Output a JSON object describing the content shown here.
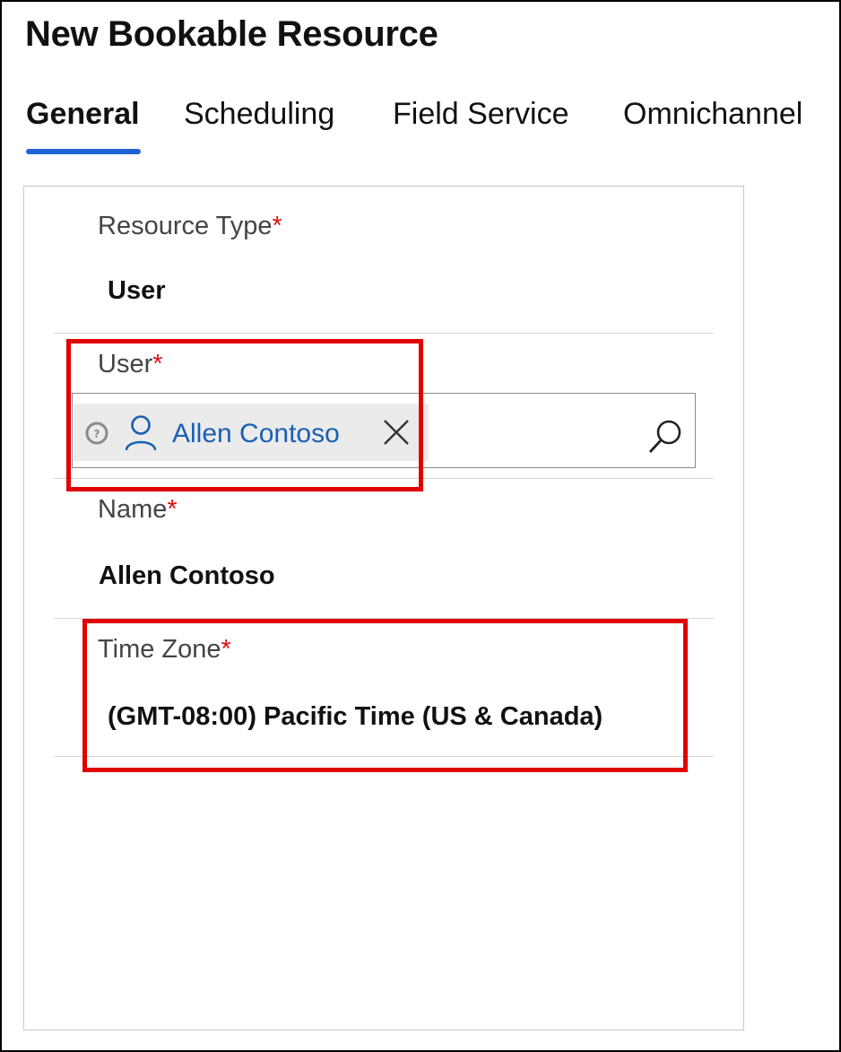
{
  "page": {
    "title": "New Bookable Resource"
  },
  "tabs": [
    {
      "label": "General",
      "active": true
    },
    {
      "label": "Scheduling",
      "active": false
    },
    {
      "label": "Field Service",
      "active": false
    },
    {
      "label": "Omnichannel",
      "active": false
    }
  ],
  "form": {
    "required_marker": "*",
    "resource_type": {
      "label": "Resource Type",
      "value": "User"
    },
    "user": {
      "label": "User",
      "value": "Allen Contoso",
      "icons": [
        "info-icon",
        "person-icon",
        "close-icon",
        "search-icon"
      ]
    },
    "name": {
      "label": "Name",
      "value": "Allen Contoso"
    },
    "time_zone": {
      "label": "Time Zone",
      "value": "(GMT-08:00) Pacific Time (US & Canada)"
    }
  },
  "colors": {
    "accent": "#1f63d6",
    "required": "#dd1111",
    "highlight": "#e00000",
    "link": "#1a5fb4"
  }
}
